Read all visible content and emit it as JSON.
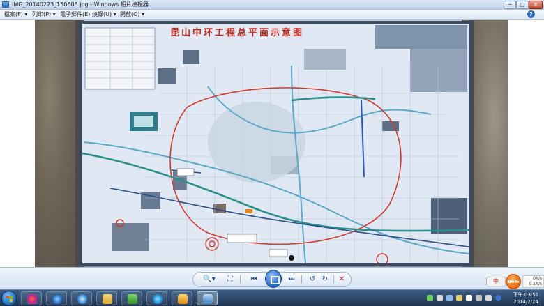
{
  "window": {
    "title": "IMG_20140223_150605.jpg - Windows 相片檢視器",
    "min_glyph": "─",
    "max_glyph": "□",
    "close_glyph": "✕"
  },
  "menu": {
    "items": [
      "檔案(F) ▾",
      "列印(P) ▾",
      "電子郵件(E)",
      "燒錄(U) ▾",
      "開啟(O) ▾"
    ],
    "help": "?"
  },
  "photo": {
    "map_title": "昆山中环工程总平面示意图"
  },
  "toolbar": {
    "zoom": "🔍▾",
    "fit": "⛶",
    "prev": "⏮",
    "next": "⏭",
    "rotate_ccw": "↺",
    "rotate_cw": "↻",
    "delete": "✕"
  },
  "tray": {
    "ime": "中",
    "speed_value": "66%",
    "upload": "0K/s",
    "download": "0.1K/s",
    "time": "下午 03:51",
    "date": "2014/2/24"
  },
  "colors": {
    "accent": "#2465c2",
    "map_title": "#c0281c",
    "speed_orange": "#e8650c"
  }
}
